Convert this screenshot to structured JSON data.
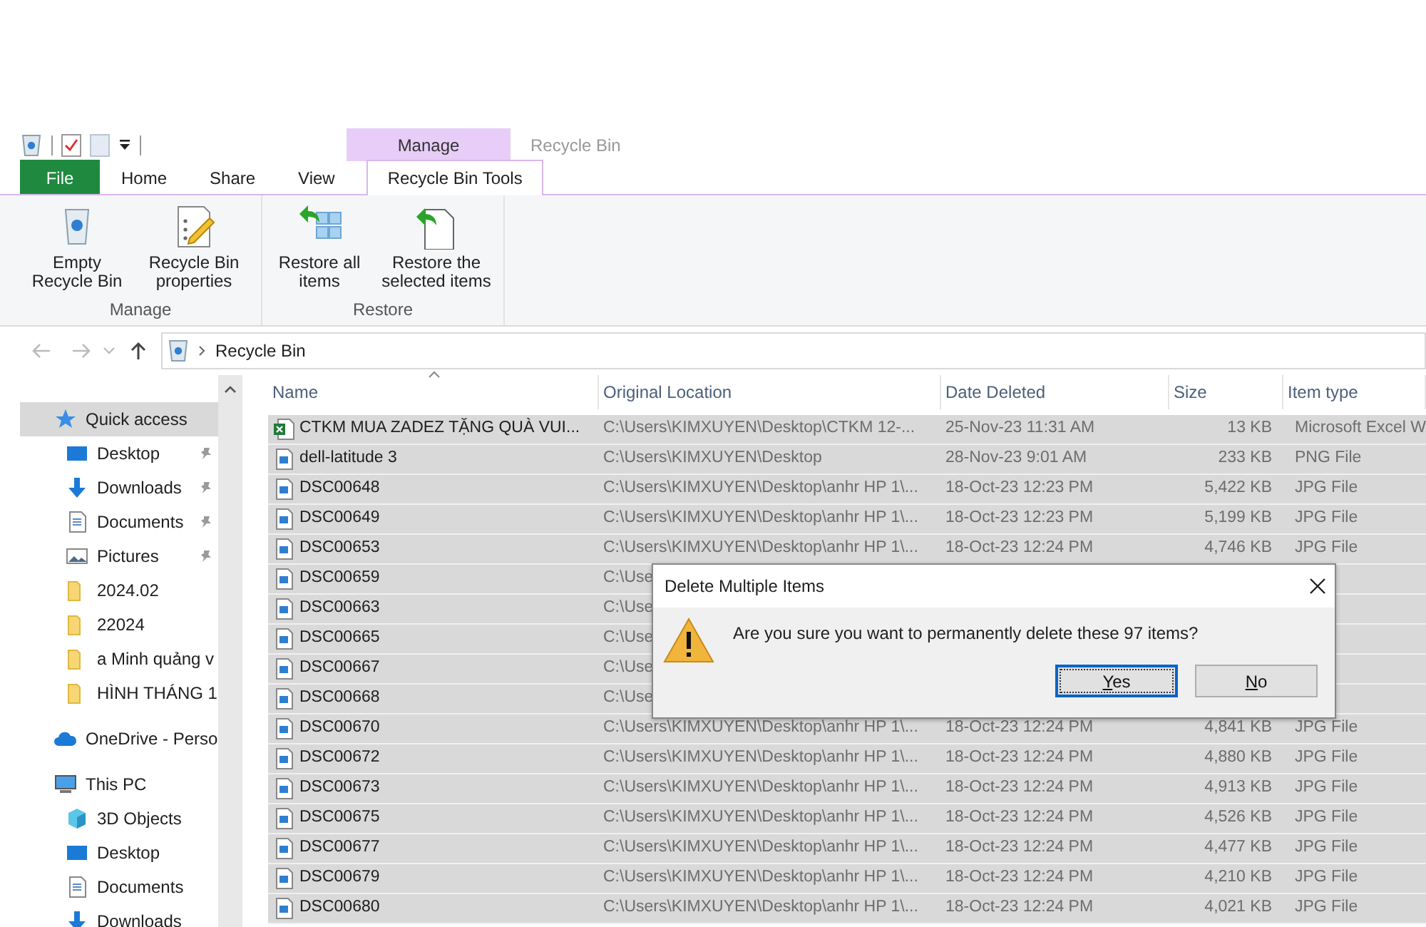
{
  "quick_access_toolbar": {
    "items": [
      {
        "kind": "recycle"
      },
      {
        "kind": "properties"
      },
      {
        "kind": "new-folder"
      },
      {
        "kind": "customize"
      }
    ]
  },
  "contextual_tab": {
    "label": "Manage"
  },
  "window": {
    "title": "Recycle Bin"
  },
  "tabs": [
    {
      "label": "File",
      "kind": "file",
      "selected": false
    },
    {
      "label": "Home",
      "kind": "tab",
      "selected": false
    },
    {
      "label": "Share",
      "kind": "tab",
      "selected": false
    },
    {
      "label": "View",
      "kind": "tab",
      "selected": false
    },
    {
      "label": "Recycle Bin Tools",
      "kind": "tab",
      "selected": true
    }
  ],
  "ribbon_groups": [
    {
      "label": "Manage",
      "buttons": [
        {
          "label": "Empty Recycle Bin",
          "kind": "empty"
        },
        {
          "label": "Recycle Bin properties",
          "kind": "properties"
        }
      ]
    },
    {
      "label": "Restore",
      "buttons": [
        {
          "label": "Restore all items",
          "kind": "restore-all"
        },
        {
          "label": "Restore the selected items",
          "kind": "restore-selected"
        }
      ]
    }
  ],
  "address_bar": {
    "path": [
      "Recycle Bin"
    ]
  },
  "sidebar": {
    "items": [
      {
        "label": "Quick access",
        "kind": "star",
        "selected": true,
        "children": [
          {
            "label": "Desktop",
            "kind": "desktop",
            "pinned": true,
            "selected": false
          },
          {
            "label": "Downloads",
            "kind": "downloads",
            "pinned": true,
            "selected": false
          },
          {
            "label": "Documents",
            "kind": "documents",
            "pinned": true,
            "selected": false
          },
          {
            "label": "Pictures",
            "kind": "pictures",
            "pinned": true,
            "selected": false
          },
          {
            "label": "2024.02",
            "kind": "folder",
            "pinned": false,
            "selected": false
          },
          {
            "label": "22024",
            "kind": "folder",
            "pinned": false,
            "selected": false
          },
          {
            "label": "a Minh quảng v",
            "kind": "folder",
            "pinned": false,
            "selected": false
          },
          {
            "label": "HÌNH THÁNG 1",
            "kind": "folder",
            "pinned": false,
            "selected": false
          }
        ]
      },
      {
        "label": "OneDrive - Perso",
        "kind": "cloud",
        "selected": false
      },
      {
        "label": "This PC",
        "kind": "pc",
        "selected": false,
        "children": [
          {
            "label": "3D Objects",
            "kind": "objects",
            "selected": false
          },
          {
            "label": "Desktop",
            "kind": "desktop",
            "selected": false
          },
          {
            "label": "Documents",
            "kind": "documents",
            "selected": false
          },
          {
            "label": "Downloads",
            "kind": "downloads",
            "selected": false
          }
        ]
      }
    ]
  },
  "table": {
    "columns": [
      {
        "label": "Name",
        "sorted": true
      },
      {
        "label": "Original Location",
        "sorted": false
      },
      {
        "label": "Date Deleted",
        "sorted": false
      },
      {
        "label": "Size",
        "sorted": false
      },
      {
        "label": "Item type",
        "sorted": false
      }
    ],
    "rows": [
      {
        "kind": "excel",
        "selected": true,
        "name": "CTKM MUA ZADEZ TẶNG QUÀ VUI...",
        "location": "C:\\Users\\KIMXUYEN\\Desktop\\CTKM 12-...",
        "date": "25-Nov-23 11:31 AM",
        "size": "13 KB",
        "type": "Microsoft Excel W"
      },
      {
        "kind": "image",
        "selected": true,
        "name": "dell-latitude 3",
        "location": "C:\\Users\\KIMXUYEN\\Desktop",
        "date": "28-Nov-23 9:01 AM",
        "size": "233 KB",
        "type": "PNG File"
      },
      {
        "kind": "image",
        "selected": true,
        "name": "DSC00648",
        "location": "C:\\Users\\KIMXUYEN\\Desktop\\anhr HP 1\\...",
        "date": "18-Oct-23 12:23 PM",
        "size": "5,422 KB",
        "type": "JPG File"
      },
      {
        "kind": "image",
        "selected": true,
        "name": "DSC00649",
        "location": "C:\\Users\\KIMXUYEN\\Desktop\\anhr HP 1\\...",
        "date": "18-Oct-23 12:23 PM",
        "size": "5,199 KB",
        "type": "JPG File"
      },
      {
        "kind": "image",
        "selected": true,
        "name": "DSC00653",
        "location": "C:\\Users\\KIMXUYEN\\Desktop\\anhr HP 1\\...",
        "date": "18-Oct-23 12:24 PM",
        "size": "4,746 KB",
        "type": "JPG File"
      },
      {
        "kind": "image",
        "selected": true,
        "name": "DSC00659",
        "location": "C:\\Use"
      },
      {
        "kind": "image",
        "selected": true,
        "name": "DSC00663",
        "location": "C:\\Use"
      },
      {
        "kind": "image",
        "selected": true,
        "name": "DSC00665",
        "location": "C:\\Use"
      },
      {
        "kind": "image",
        "selected": true,
        "name": "DSC00667",
        "location": "C:\\Use"
      },
      {
        "kind": "image",
        "selected": true,
        "name": "DSC00668",
        "location": "C:\\Use"
      },
      {
        "kind": "image",
        "selected": true,
        "name": "DSC00670",
        "location": "C:\\Users\\KIMXUYEN\\Desktop\\anhr HP 1\\...",
        "date": "18-Oct-23 12:24 PM",
        "size": "4,841 KB",
        "type": "JPG File"
      },
      {
        "kind": "image",
        "selected": true,
        "name": "DSC00672",
        "location": "C:\\Users\\KIMXUYEN\\Desktop\\anhr HP 1\\...",
        "date": "18-Oct-23 12:24 PM",
        "size": "4,880 KB",
        "type": "JPG File"
      },
      {
        "kind": "image",
        "selected": true,
        "name": "DSC00673",
        "location": "C:\\Users\\KIMXUYEN\\Desktop\\anhr HP 1\\...",
        "date": "18-Oct-23 12:24 PM",
        "size": "4,913 KB",
        "type": "JPG File"
      },
      {
        "kind": "image",
        "selected": true,
        "name": "DSC00675",
        "location": "C:\\Users\\KIMXUYEN\\Desktop\\anhr HP 1\\...",
        "date": "18-Oct-23 12:24 PM",
        "size": "4,526 KB",
        "type": "JPG File"
      },
      {
        "kind": "image",
        "selected": true,
        "name": "DSC00677",
        "location": "C:\\Users\\KIMXUYEN\\Desktop\\anhr HP 1\\...",
        "date": "18-Oct-23 12:24 PM",
        "size": "4,477 KB",
        "type": "JPG File"
      },
      {
        "kind": "image",
        "selected": true,
        "name": "DSC00679",
        "location": "C:\\Users\\KIMXUYEN\\Desktop\\anhr HP 1\\...",
        "date": "18-Oct-23 12:24 PM",
        "size": "4,210 KB",
        "type": "JPG File"
      },
      {
        "kind": "image",
        "selected": true,
        "name": "DSC00680",
        "location": "C:\\Users\\KIMXUYEN\\Desktop\\anhr HP 1\\...",
        "date": "18-Oct-23 12:24 PM",
        "size": "4,021 KB",
        "type": "JPG File"
      }
    ]
  },
  "dialog": {
    "title": "Delete Multiple Items",
    "message": "Are you sure you want to permanently delete these 97 items?",
    "buttons": [
      {
        "label": "Yes",
        "default": true
      },
      {
        "label": "No",
        "default": false
      }
    ]
  }
}
